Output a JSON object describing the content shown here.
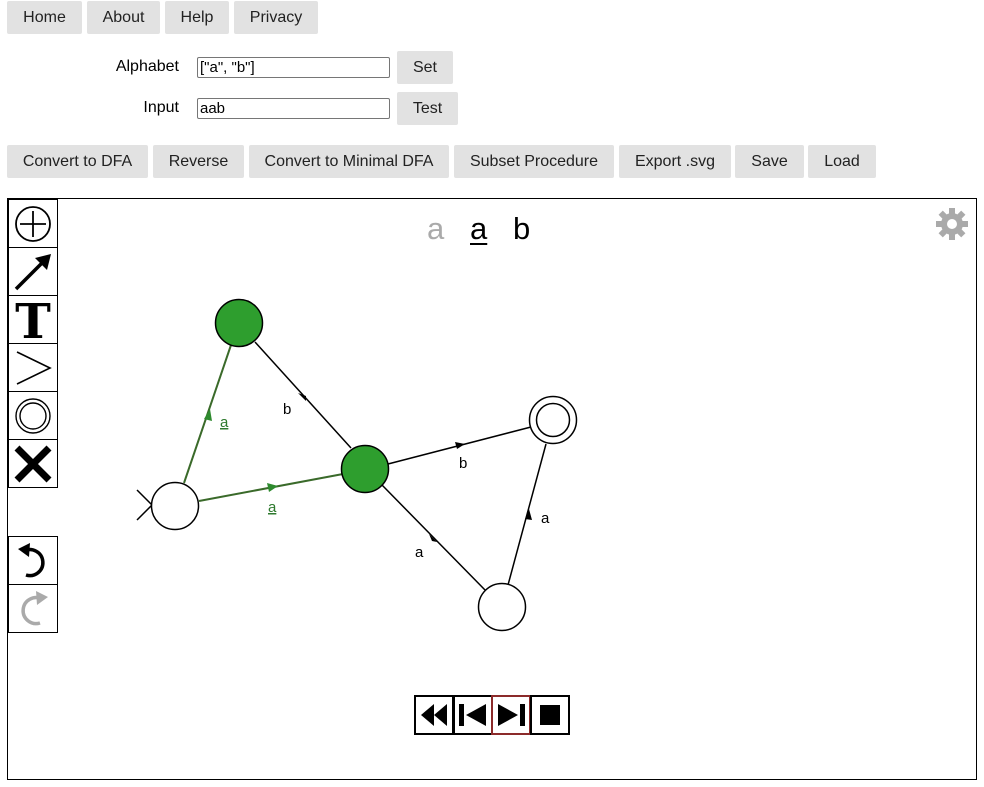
{
  "nav": {
    "home": "Home",
    "about": "About",
    "help": "Help",
    "privacy": "Privacy"
  },
  "form": {
    "alphabet_label": "Alphabet",
    "alphabet_value": "[\"a\", \"b\"]",
    "set_label": "Set",
    "input_label": "Input",
    "input_value": "aab",
    "test_label": "Test"
  },
  "toolbar": {
    "convert_dfa": "Convert to DFA",
    "reverse": "Reverse",
    "convert_min_dfa": "Convert to Minimal DFA",
    "subset": "Subset Procedure",
    "export_svg": "Export .svg",
    "save": "Save",
    "load": "Load"
  },
  "input_display": {
    "chars": [
      "a",
      "a",
      "b"
    ],
    "current_index": 1
  },
  "automaton": {
    "transition_labels": {
      "q0_to_q1": "a",
      "q0_to_q2": "a",
      "q1_to_q2": "b",
      "q2_to_q3": "b",
      "q2_to_q4": "a",
      "q4_to_q3": "a"
    },
    "active_color": "#2e9e2e",
    "active_edge_color": "#3a6a2a"
  },
  "tools": {
    "icons": [
      "add-state-icon",
      "arrow-icon",
      "text-icon",
      "start-state-icon",
      "accept-state-icon",
      "delete-icon",
      "undo-icon",
      "redo-icon",
      "gear-icon"
    ]
  },
  "player": {
    "icons": [
      "rewind-icon",
      "step-back-icon",
      "step-forward-icon",
      "stop-icon"
    ]
  }
}
